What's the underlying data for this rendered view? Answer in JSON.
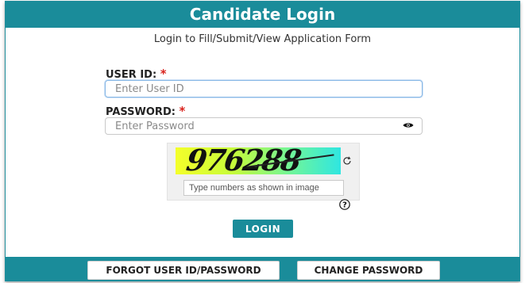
{
  "header": {
    "title": "Candidate Login"
  },
  "subtitle": "Login to Fill/Submit/View Application Form",
  "form": {
    "user_id": {
      "label": "USER ID:",
      "required_mark": "*",
      "placeholder": "Enter User ID",
      "value": ""
    },
    "password": {
      "label": "PASSWORD:",
      "required_mark": "*",
      "placeholder": "Enter Password",
      "value": ""
    }
  },
  "captcha": {
    "code": "976288",
    "input_placeholder": "Type numbers as shown in image",
    "refresh_icon": "refresh-icon",
    "help_icon": "question-circle-icon"
  },
  "buttons": {
    "login": "LOGIN",
    "forgot": "FORGOT USER ID/PASSWORD",
    "change_password": "CHANGE PASSWORD"
  },
  "colors": {
    "primary": "#1a8c9a",
    "required": "#d9221c"
  }
}
